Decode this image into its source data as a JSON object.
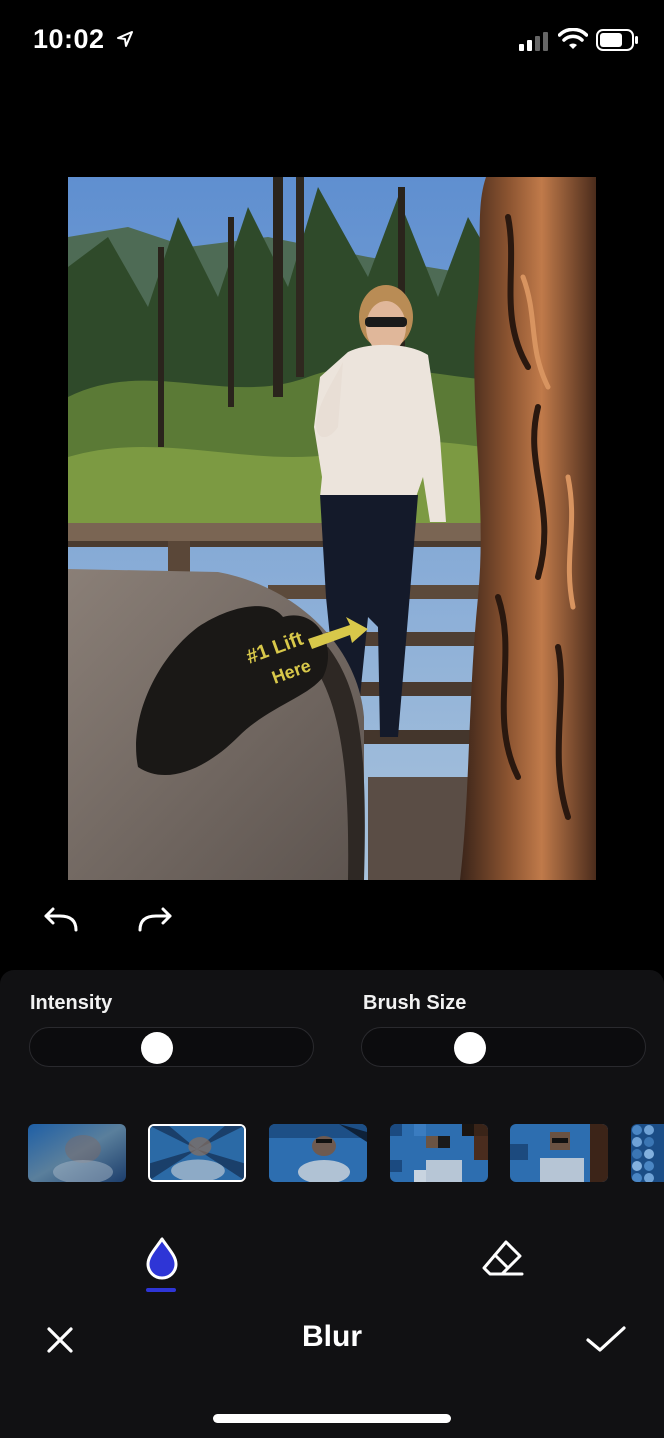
{
  "status_bar": {
    "time": "10:02",
    "icons": [
      "location-arrow-icon",
      "cellular-signal-icon",
      "wifi-icon",
      "battery-icon"
    ]
  },
  "editor": {
    "photo_description_icon": "photo-canvas",
    "undo_icon": "undo-icon",
    "redo_icon": "redo-icon"
  },
  "controls": {
    "intensity": {
      "label": "Intensity",
      "value": 0.45
    },
    "brush_size": {
      "label": "Brush Size",
      "value": 0.38
    }
  },
  "effects": {
    "items": [
      "blur-soft",
      "blur-zoom",
      "blur-motion",
      "pixelate-small",
      "pixelate-large",
      "mosaic"
    ],
    "selected_index": 1
  },
  "tools": {
    "active": "blur-drop-icon",
    "items": [
      "blur-drop-icon",
      "eraser-icon"
    ],
    "accent_color": "#2e35d6"
  },
  "bottom_bar": {
    "title": "Blur",
    "cancel_icon": "close-icon",
    "confirm_icon": "checkmark-icon"
  }
}
